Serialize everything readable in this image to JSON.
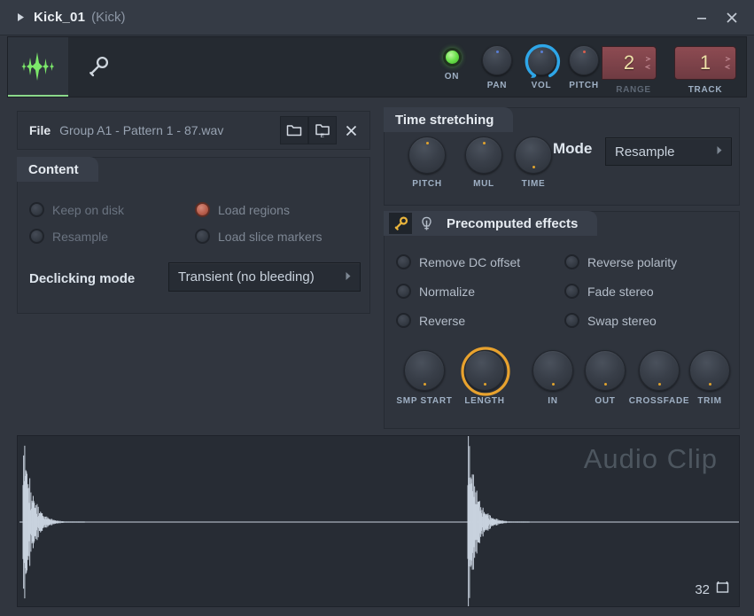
{
  "window": {
    "title": "Kick_01",
    "subtitle": "(Kick)",
    "expand_icon": "triangle-right-icon",
    "minimize_label": "–",
    "close_label": "✕"
  },
  "toolbar": {
    "tabs": [
      {
        "name": "waveform-tab",
        "icon": "waveform-icon",
        "active": true
      },
      {
        "name": "tools-tab",
        "icon": "wrench-icon",
        "active": false
      }
    ],
    "controls": [
      {
        "name": "on",
        "label": "ON",
        "type": "led",
        "state": "on"
      },
      {
        "name": "pan",
        "label": "PAN",
        "type": "knob",
        "indicator": "blue-top"
      },
      {
        "name": "vol",
        "label": "VOL",
        "type": "knob-arc",
        "indicator": "blue-top",
        "arc_color": "#2ea6e8"
      },
      {
        "name": "pitch",
        "label": "PITCH",
        "type": "knob",
        "indicator": "red-top"
      },
      {
        "name": "range",
        "label": "RANGE",
        "type": "numbox",
        "value": "2",
        "dim": true
      },
      {
        "name": "track",
        "label": "TRACK",
        "type": "numbox",
        "value": "1",
        "dim": false
      }
    ]
  },
  "file": {
    "label": "File",
    "value": "Group A1 - Pattern 1 - 87.wav",
    "buttons": [
      {
        "name": "open-file-button",
        "icon": "folder-icon"
      },
      {
        "name": "save-file-button",
        "icon": "folder-save-icon"
      },
      {
        "name": "close-file-button",
        "icon": "close-icon"
      }
    ]
  },
  "content": {
    "title": "Content",
    "options": [
      {
        "name": "keep-on-disk",
        "label": "Keep on disk",
        "checked": false
      },
      {
        "name": "load-regions",
        "label": "Load regions",
        "checked": true
      },
      {
        "name": "resample",
        "label": "Resample",
        "checked": false
      },
      {
        "name": "load-slice-markers",
        "label": "Load slice markers",
        "checked": false
      }
    ],
    "declicking_label": "Declicking mode",
    "declicking_value": "Transient (no bleeding)"
  },
  "time_stretching": {
    "title": "Time stretching",
    "knobs": [
      {
        "name": "pitch",
        "label": "PITCH",
        "indicator": "yellow-top"
      },
      {
        "name": "mul",
        "label": "MUL",
        "indicator": "yellow-top"
      },
      {
        "name": "time",
        "label": "TIME",
        "indicator": "yellow-bottom"
      }
    ],
    "mode_label": "Mode",
    "mode_value": "Resample"
  },
  "precomputed_effects": {
    "title": "Precomputed effects",
    "header_icons": [
      {
        "name": "wrench-icon",
        "active": true,
        "color": "#e9b43c"
      },
      {
        "name": "pin-icon",
        "active": false
      }
    ],
    "options": [
      {
        "name": "remove-dc-offset",
        "label": "Remove DC offset",
        "checked": false
      },
      {
        "name": "reverse-polarity",
        "label": "Reverse polarity",
        "checked": false
      },
      {
        "name": "normalize",
        "label": "Normalize",
        "checked": false
      },
      {
        "name": "fade-stereo",
        "label": "Fade stereo",
        "checked": false
      },
      {
        "name": "reverse",
        "label": "Reverse",
        "checked": false
      },
      {
        "name": "swap-stereo",
        "label": "Swap stereo",
        "checked": false
      }
    ],
    "knobs": [
      {
        "name": "smp-start",
        "label": "SMP START",
        "highlight": false
      },
      {
        "name": "length",
        "label": "LENGTH",
        "highlight": true,
        "highlight_color": "#e8a22e"
      },
      {
        "name": "in",
        "label": "IN",
        "highlight": false
      },
      {
        "name": "out",
        "label": "OUT",
        "highlight": false
      },
      {
        "name": "crossfade",
        "label": "CROSSFADE",
        "highlight": false
      },
      {
        "name": "trim",
        "label": "TRIM",
        "highlight": false
      }
    ]
  },
  "waveform": {
    "watermark": "Audio Clip",
    "zoom_value": "32",
    "zoom_icon": "fit-box-icon",
    "color": "#c8d2de"
  }
}
